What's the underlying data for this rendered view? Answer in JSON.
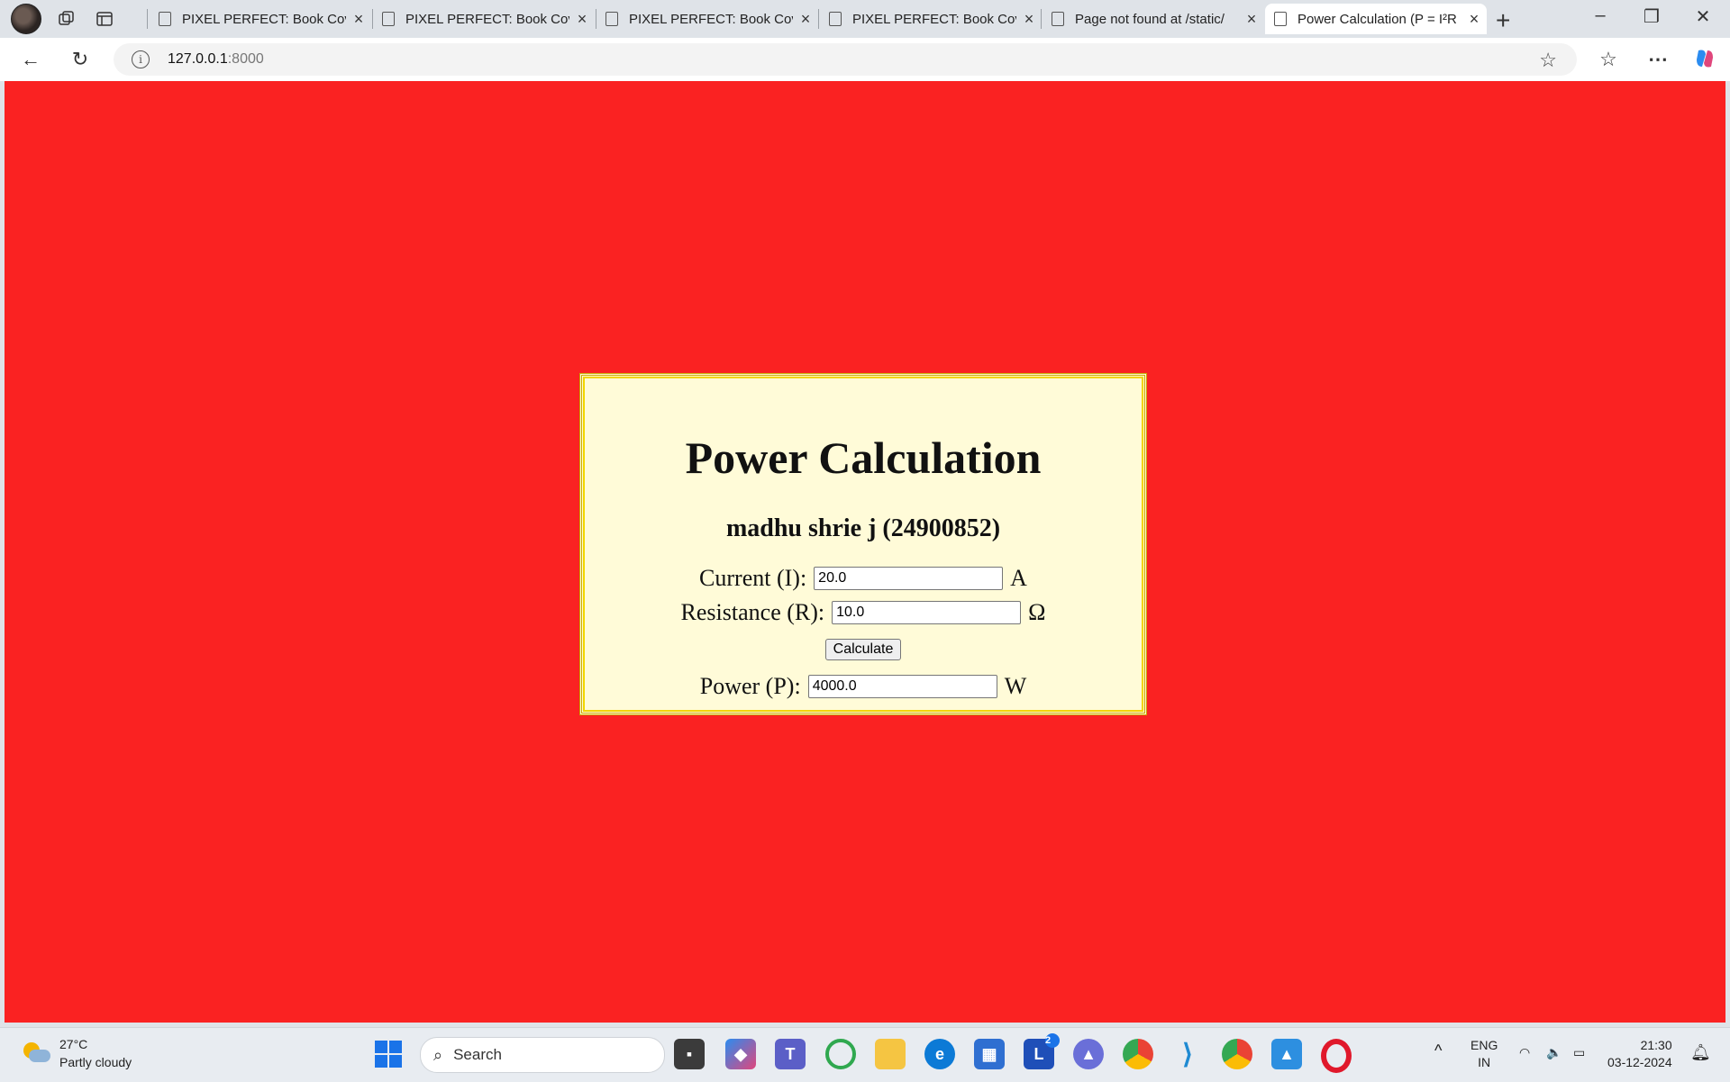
{
  "browser": {
    "tabs": [
      {
        "title": "PIXEL PERFECT: Book Cov",
        "active": false
      },
      {
        "title": "PIXEL PERFECT: Book Cov",
        "active": false
      },
      {
        "title": "PIXEL PERFECT: Book Cov",
        "active": false
      },
      {
        "title": "PIXEL PERFECT: Book Cov",
        "active": false
      },
      {
        "title": "Page not found at /static/",
        "active": false
      },
      {
        "title": "Power Calculation (P = I²R",
        "active": true
      }
    ],
    "url_host": "127.0.0.1",
    "url_port": ":8000"
  },
  "page": {
    "background_color": "#fa2222",
    "card_color": "#fffbd8",
    "title": "Power Calculation",
    "subtitle": "madhu shrie j (24900852)",
    "current": {
      "label": "Current (I):",
      "value": "20.0",
      "unit": "A"
    },
    "resistance": {
      "label": "Resistance (R):",
      "value": "10.0",
      "unit": "Ω"
    },
    "calculate_label": "Calculate",
    "power": {
      "label": "Power (P):",
      "value": "4000.0",
      "unit": "W"
    }
  },
  "taskbar": {
    "weather_temp": "27°C",
    "weather_desc": "Partly cloudy",
    "search_label": "Search",
    "lang_line1": "ENG",
    "lang_line2": "IN",
    "time": "21:30",
    "date": "03-12-2024",
    "notification_badge": "2",
    "apps": [
      "file-explorer-dark-icon",
      "copilot-icon",
      "teams-icon",
      "circle-app-icon",
      "folder-icon",
      "edge-icon",
      "store-icon",
      "l-app-icon",
      "delta-app-icon",
      "chrome-icon",
      "vscode-icon",
      "chrome-profile-icon",
      "photos-icon",
      "opera-icon"
    ]
  }
}
